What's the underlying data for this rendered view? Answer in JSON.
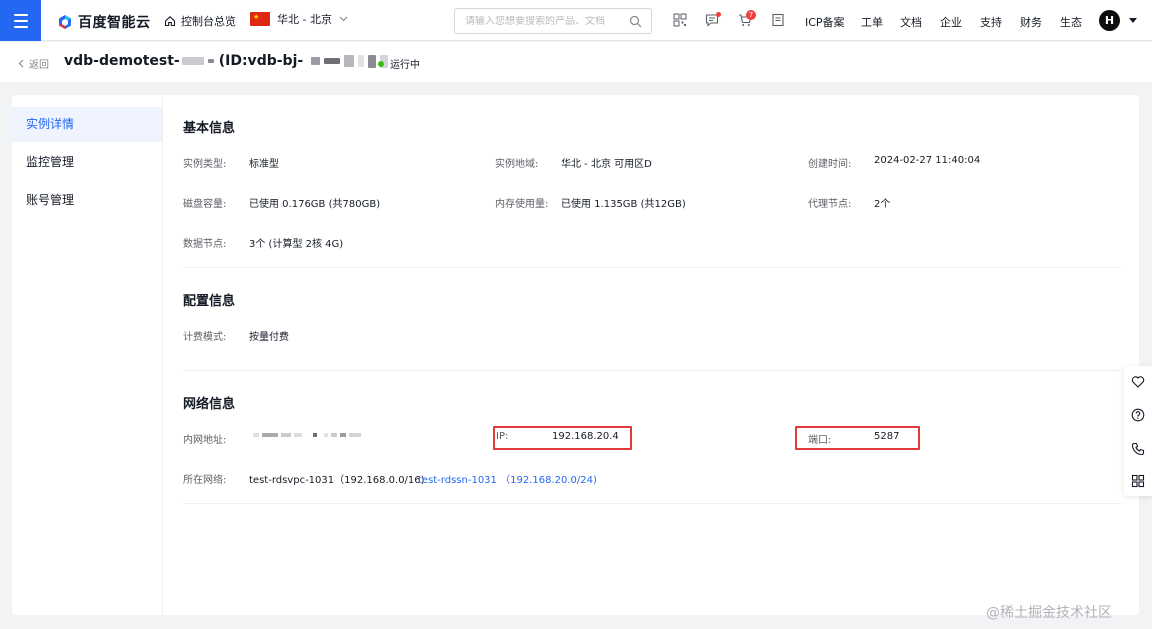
{
  "topbar": {
    "logo_text": "百度智能云",
    "home_label": "控制台总览",
    "region_label": "华北 - 北京",
    "search_placeholder": "请输入您想要搜索的产品、文档",
    "cart_badge": "7",
    "links": [
      "ICP备案",
      "工单",
      "文档",
      "企业",
      "支持",
      "财务",
      "生态"
    ],
    "avatar_letter": "H"
  },
  "header": {
    "back_label": "返回",
    "title_prefix": "vdb-demotest-",
    "title_id_prefix": "(ID:vdb-bj-",
    "status_text": "运行中"
  },
  "sidebar": {
    "items": [
      {
        "label": "实例详情",
        "active": true
      },
      {
        "label": "监控管理",
        "active": false
      },
      {
        "label": "账号管理",
        "active": false
      }
    ]
  },
  "basic": {
    "title": "基本信息",
    "instance_type_label": "实例类型:",
    "instance_type": "标准型",
    "region_label": "实例地域:",
    "region": "华北 - 北京 可用区D",
    "created_label": "创建时间:",
    "created": "2024-02-27 11:40:04",
    "disk_label": "磁盘容量:",
    "disk": "已使用 0.176GB (共780GB)",
    "mem_label": "内存使用量:",
    "mem": "已使用 1.135GB (共12GB)",
    "proxy_label": "代理节点:",
    "proxy": "2个",
    "data_nodes_label": "数据节点:",
    "data_nodes": "3个 (计算型 2核 4G)"
  },
  "config": {
    "title": "配置信息",
    "billing_label": "计费模式:",
    "billing": "按量付费"
  },
  "network": {
    "title": "网络信息",
    "intranet_label": "内网地址:",
    "ip_label": "IP:",
    "ip": "192.168.20.4",
    "port_label": "端口:",
    "port": "5287",
    "vpc_label": "所在网络:",
    "vpc": "test-rdsvpc-1031（192.168.0.0/16)",
    "subnet": "test-rdssn-1031 （192.168.20.0/24)"
  },
  "watermark": "@稀土掘金技术社区",
  "colors": {
    "brand": "#2468f2",
    "status_running": "#30bf13",
    "highlight_box": "#e23a3a"
  }
}
